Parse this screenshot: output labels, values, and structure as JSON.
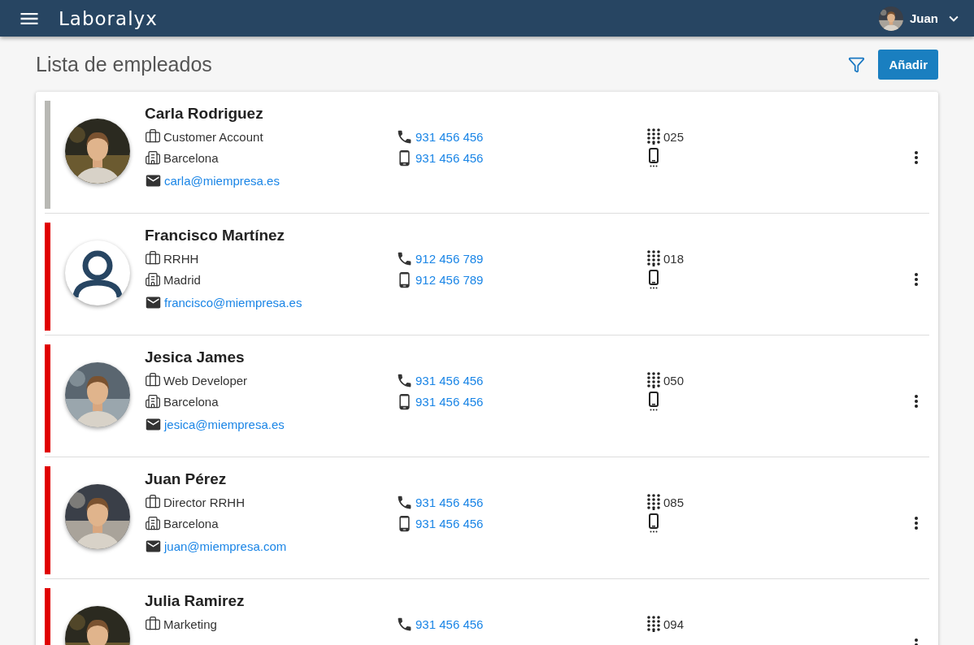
{
  "app_bar": {
    "logo": "Laboralyx",
    "user": {
      "name": "Juan"
    }
  },
  "page": {
    "title": "Lista de empleados",
    "add_button": "Añadir"
  },
  "employees": [
    {
      "name": "Carla Rodriguez",
      "color": "#b8b8b4",
      "department": "Customer Account",
      "city": "Barcelona",
      "email": "carla@miempresa.es",
      "phone": "931 456 456",
      "mobile": "931 456 456",
      "extension": "025",
      "mobile_extension": true
    },
    {
      "name": "Francisco Martínez",
      "color": "#e00000",
      "avatar": {
        "kind": "placeholder"
      },
      "department": "RRHH",
      "city": "Madrid",
      "email": "francisco@miempresa.es",
      "phone": "912 456 789",
      "mobile": "912 456 789",
      "extension": "018",
      "mobile_extension": true
    },
    {
      "name": "Jesica James",
      "color": "#e00000",
      "department": "Web Developer",
      "city": "Barcelona",
      "email": "jesica@miempresa.es",
      "phone": "931 456 456",
      "mobile": "931 456 456",
      "extension": "050",
      "mobile_extension": true
    },
    {
      "name": "Juan Pérez",
      "color": "#e00000",
      "department": "Director RRHH",
      "city": "Barcelona",
      "email": "juan@miempresa.com",
      "phone": "931 456 456",
      "mobile": "931 456 456",
      "extension": "085",
      "mobile_extension": true
    },
    {
      "name": "Julia Ramirez",
      "color": "#e00000",
      "department": "Marketing",
      "phone": "931 456 456",
      "extension": "094"
    }
  ]
}
